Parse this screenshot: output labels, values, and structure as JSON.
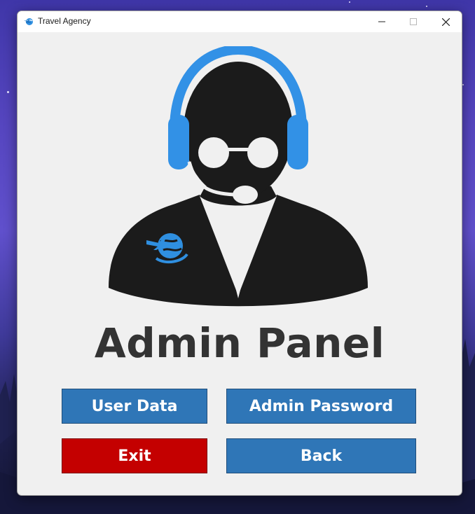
{
  "window": {
    "title": "Travel Agency",
    "icon": "globe-plane-icon"
  },
  "controls": {
    "minimize": "minimize-icon",
    "maximize": "maximize-icon",
    "close": "close-icon"
  },
  "main": {
    "heading": "Admin Panel",
    "illustration": "support-agent-headset-icon",
    "buttons": {
      "user_data": "User Data",
      "admin_password": "Admin Password",
      "exit": "Exit",
      "back": "Back"
    }
  },
  "colors": {
    "accent_blue": "#2f76b7",
    "exit_red": "#c40000",
    "headset_blue": "#3291e6",
    "figure_black": "#1b1b1b",
    "heading_gray": "#333333",
    "window_bg": "#f0f0f0"
  }
}
